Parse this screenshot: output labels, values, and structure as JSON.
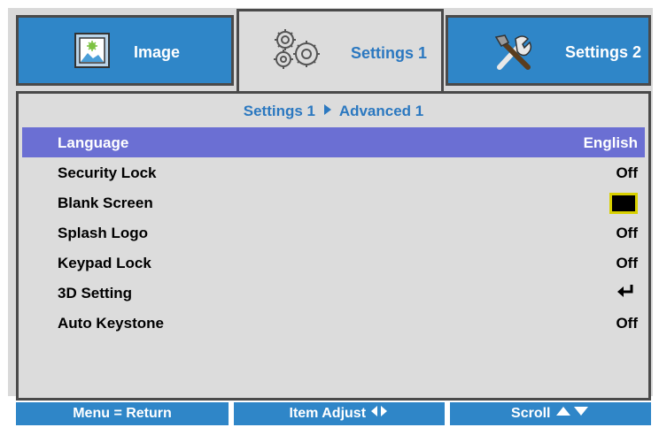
{
  "tabs": [
    {
      "label": "Image",
      "icon": "image-icon"
    },
    {
      "label": "Settings 1",
      "icon": "gears-icon"
    },
    {
      "label": "Settings 2",
      "icon": "tools-icon"
    }
  ],
  "breadcrumb": {
    "parent": "Settings 1",
    "child": "Advanced 1"
  },
  "menu": {
    "items": [
      {
        "label": "Language",
        "value": "English"
      },
      {
        "label": "Security Lock",
        "value": "Off"
      },
      {
        "label": "Blank Screen",
        "value": ""
      },
      {
        "label": "Splash Logo",
        "value": "Off"
      },
      {
        "label": "Keypad Lock",
        "value": "Off"
      },
      {
        "label": "3D Setting",
        "value": "↵"
      },
      {
        "label": "Auto Keystone",
        "value": "Off"
      }
    ]
  },
  "footer": {
    "menu_return": "Menu = Return",
    "item_adjust": "Item Adjust",
    "scroll": "Scroll"
  },
  "colors": {
    "accent": "#2f86c8",
    "selection": "#6b6fd3",
    "panel": "#dcdcdc",
    "border": "#4a4a4a",
    "blank_screen_swatch": "#000000",
    "blank_screen_outline": "#d8d000"
  }
}
